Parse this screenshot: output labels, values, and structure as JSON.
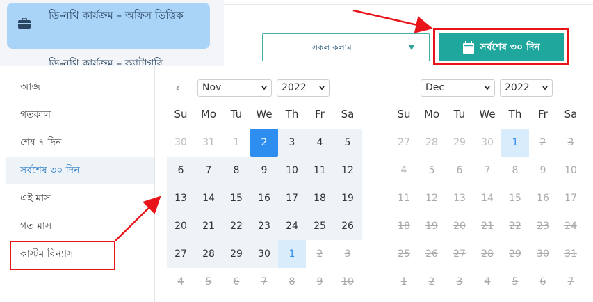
{
  "sidebar": {
    "active_item": "ডি-নথি কার্যক্রম – অফিস ভিত্তিক",
    "next_item": "ডি-নথি কার্যক্রম – ক্যাটাগরি"
  },
  "filter": {
    "column_select": "সকল কলাম",
    "range_button": "সর্বশেষ ৩০ দিন"
  },
  "ranges": [
    {
      "label": "আজ"
    },
    {
      "label": "গতকাল"
    },
    {
      "label": "শেষ ৭ দিন"
    },
    {
      "label": "সর্বশেষ ৩০ দিন"
    },
    {
      "label": "এই মাস"
    },
    {
      "label": "গত মাস"
    },
    {
      "label": "কাস্টম বিন্যাস"
    }
  ],
  "calendar_left": {
    "month": "Nov",
    "year": "2022",
    "weekdays": [
      "Su",
      "Mo",
      "Tu",
      "We",
      "Th",
      "Fr",
      "Sa"
    ],
    "weeks": [
      [
        "30",
        "31",
        "1",
        "2",
        "3",
        "4",
        "5"
      ],
      [
        "6",
        "7",
        "8",
        "9",
        "10",
        "11",
        "12"
      ],
      [
        "13",
        "14",
        "15",
        "16",
        "17",
        "18",
        "19"
      ],
      [
        "20",
        "21",
        "22",
        "23",
        "24",
        "25",
        "26"
      ],
      [
        "27",
        "28",
        "29",
        "30",
        "1",
        "2",
        "3"
      ],
      [
        "4",
        "5",
        "6",
        "7",
        "8",
        "9",
        "10"
      ]
    ]
  },
  "calendar_right": {
    "month": "Dec",
    "year": "2022",
    "weekdays": [
      "Su",
      "Mo",
      "Tu",
      "We",
      "Th",
      "Fr",
      "Sa"
    ],
    "weeks": [
      [
        "27",
        "28",
        "29",
        "30",
        "1",
        "2",
        "3"
      ],
      [
        "4",
        "5",
        "6",
        "7",
        "8",
        "9",
        "10"
      ],
      [
        "11",
        "12",
        "13",
        "14",
        "15",
        "16",
        "17"
      ],
      [
        "18",
        "19",
        "20",
        "21",
        "22",
        "23",
        "24"
      ],
      [
        "25",
        "26",
        "27",
        "28",
        "29",
        "30",
        "31"
      ],
      [
        "1",
        "2",
        "3",
        "4",
        "5",
        "6",
        "7"
      ]
    ]
  },
  "colors": {
    "accent": "#1fa79e",
    "selected": "#2d8ef0",
    "highlight": "#e8141a"
  }
}
